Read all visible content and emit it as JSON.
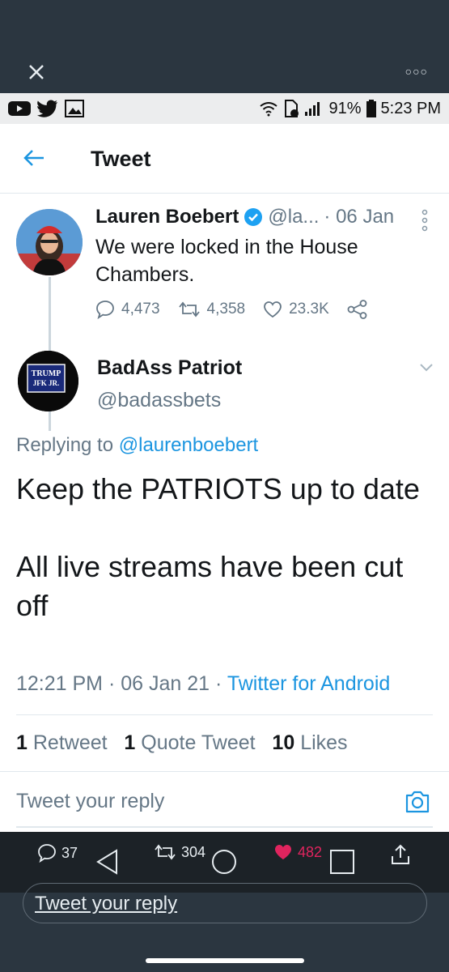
{
  "colors": {
    "topbar": "#2b3640",
    "blue": "#1b95e0",
    "grey": "#657786",
    "heart": "#e0245e"
  },
  "status": {
    "battery": "91%",
    "time": "5:23 PM"
  },
  "header": {
    "title": "Tweet"
  },
  "parent_tweet": {
    "name": "Lauren Boebert",
    "handle": "@la...",
    "date": "· 06 Jan",
    "text": "We were locked in the House Chambers.",
    "replies": "4,473",
    "retweets": "4,358",
    "likes": "23.3K"
  },
  "reply_tweet": {
    "name": "BadAss Patriot",
    "handle": "@badassbets",
    "avatar_text": "TRUMP JFK JR.",
    "replying_prefix": "Replying to",
    "replying_to": "@laurenboebert",
    "body_1": "Keep the PATRIOTS up to date",
    "body_2": "All live streams have been cut off",
    "time": "12:21 PM · 06 Jan 21 ·",
    "client": "Twitter for Android",
    "retweet_count": "1",
    "retweet_label": "Retweet",
    "quote_count": "1",
    "quote_label": "Quote Tweet",
    "likes_count": "10",
    "likes_label": "Likes"
  },
  "composer": {
    "placeholder": "Tweet your reply"
  },
  "bottom_nav": {
    "replies": "37",
    "retweets": "304",
    "likes": "482",
    "reply_pill": "Tweet your reply"
  }
}
